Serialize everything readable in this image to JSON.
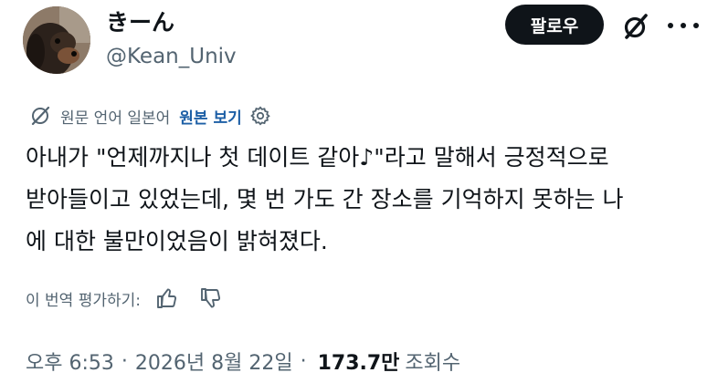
{
  "author": {
    "display_name": "きーん",
    "handle": "@Kean_Univ"
  },
  "header": {
    "follow_label": "팔로우",
    "grok_icon": "grok-icon",
    "more_icon": "more-icon"
  },
  "translation": {
    "icon": "globe-slash-icon",
    "source_text": "원문 언어 일본어",
    "show_original_label": "원본 보기",
    "settings_icon": "gear-icon"
  },
  "tweet": {
    "lines": [
      "아내가 \"언제까지나 첫 데이트 같아♪\"라고 말해서 긍정적으로",
      "받아들이고 있었는데, 몇 번 가도 간 장소를 기억하지 못하는 나",
      "에 대한 불만이었음이 밝혀졌다."
    ]
  },
  "rating": {
    "label": "이 번역 평가하기:",
    "like_icon": "thumbs-up-icon",
    "dislike_icon": "thumbs-down-icon"
  },
  "meta": {
    "time": "오후 6:53",
    "separator": "·",
    "date": "2026년 8월 22일",
    "views_count": "173.7만",
    "views_label": "조회수"
  },
  "colors": {
    "text": "#0f1419",
    "secondary": "#536471",
    "link": "#1d5fa6",
    "button_bg": "#0f1419"
  }
}
